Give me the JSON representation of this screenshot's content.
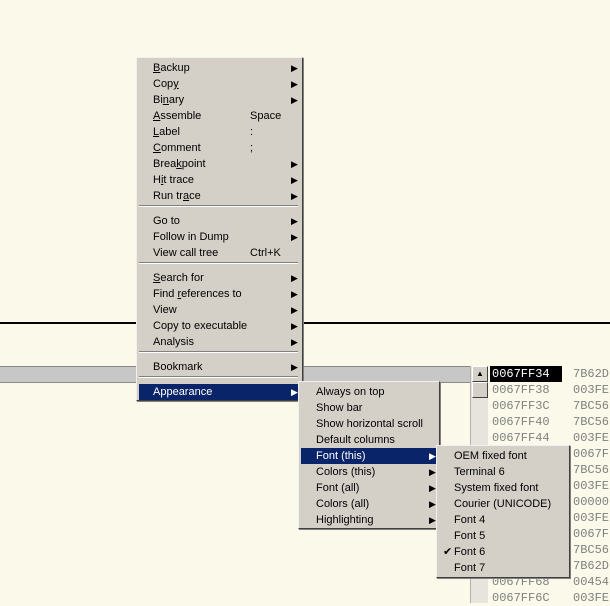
{
  "main_menu": {
    "items": [
      {
        "pre": "",
        "u": "B",
        "post": "ackup",
        "shortcut": "",
        "arrow": "▶"
      },
      {
        "pre": "Cop",
        "u": "y",
        "post": "",
        "shortcut": "",
        "arrow": "▶"
      },
      {
        "pre": "Bi",
        "u": "n",
        "post": "ary",
        "shortcut": "",
        "arrow": "▶"
      },
      {
        "pre": "",
        "u": "A",
        "post": "ssemble",
        "shortcut": "Space",
        "arrow": ""
      },
      {
        "pre": "",
        "u": "L",
        "post": "abel",
        "shortcut": ":",
        "arrow": ""
      },
      {
        "pre": "",
        "u": "C",
        "post": "omment",
        "shortcut": ";",
        "arrow": ""
      },
      {
        "pre": "Brea",
        "u": "k",
        "post": "point",
        "shortcut": "",
        "arrow": "▶"
      },
      {
        "pre": "H",
        "u": "i",
        "post": "t trace",
        "shortcut": "",
        "arrow": "▶"
      },
      {
        "pre": "Run tr",
        "u": "a",
        "post": "ce",
        "shortcut": "",
        "arrow": "▶"
      },
      {
        "pre": "Go to",
        "u": "",
        "post": "",
        "shortcut": "",
        "arrow": "▶"
      },
      {
        "pre": "Follow in Dump",
        "u": "",
        "post": "",
        "shortcut": "",
        "arrow": "▶"
      },
      {
        "pre": "View call tree",
        "u": "",
        "post": "",
        "shortcut": "Ctrl+K",
        "arrow": ""
      },
      {
        "pre": "",
        "u": "S",
        "post": "earch for",
        "shortcut": "",
        "arrow": "▶"
      },
      {
        "pre": "Find ",
        "u": "r",
        "post": "eferences to",
        "shortcut": "",
        "arrow": "▶"
      },
      {
        "pre": "View",
        "u": "",
        "post": "",
        "shortcut": "",
        "arrow": "▶"
      },
      {
        "pre": "Copy to executable",
        "u": "",
        "post": "",
        "shortcut": "",
        "arrow": "▶"
      },
      {
        "pre": "Analysis",
        "u": "",
        "post": "",
        "shortcut": "",
        "arrow": "▶"
      },
      {
        "pre": "Bookmark",
        "u": "",
        "post": "",
        "shortcut": "",
        "arrow": "▶"
      },
      {
        "pre": "Appearance",
        "u": "",
        "post": "",
        "shortcut": "",
        "arrow": "▶"
      }
    ]
  },
  "appearance_menu": {
    "items": [
      {
        "label": "Always on top",
        "arrow": ""
      },
      {
        "label": "Show bar",
        "arrow": ""
      },
      {
        "label": "Show horizontal scroll",
        "arrow": ""
      },
      {
        "label": "Default columns",
        "arrow": ""
      },
      {
        "label": "Font (this)",
        "arrow": "▶"
      },
      {
        "label": "Colors (this)",
        "arrow": "▶"
      },
      {
        "label": "Font (all)",
        "arrow": "▶"
      },
      {
        "label": "Colors (all)",
        "arrow": "▶"
      },
      {
        "label": "Highlighting",
        "arrow": "▶"
      }
    ]
  },
  "font_menu": {
    "items": [
      {
        "label": "OEM fixed font",
        "check": ""
      },
      {
        "label": "Terminal 6",
        "check": ""
      },
      {
        "label": "System fixed font",
        "check": ""
      },
      {
        "label": "Courier (UNICODE)",
        "check": ""
      },
      {
        "label": "Font 4",
        "check": ""
      },
      {
        "label": "Font 5",
        "check": ""
      },
      {
        "label": "Font 6",
        "check": "✔"
      },
      {
        "label": "Font 7",
        "check": ""
      }
    ]
  },
  "scrollbar": {
    "up_arrow": "▲"
  },
  "stack": {
    "rows": [
      {
        "addr": "0067FF34",
        "val": "7B62D"
      },
      {
        "addr": "0067FF38",
        "val": "003FE"
      },
      {
        "addr": "0067FF3C",
        "val": "7BC56"
      },
      {
        "addr": "0067FF40",
        "val": "7BC56"
      },
      {
        "addr": "0067FF44",
        "val": "003FE"
      },
      {
        "addr": "",
        "val": "0067F"
      },
      {
        "addr": "",
        "val": "7BC56"
      },
      {
        "addr": "",
        "val": "003FE"
      },
      {
        "addr": "",
        "val": "00000"
      },
      {
        "addr": "",
        "val": "003FE"
      },
      {
        "addr": "",
        "val": "0067F"
      },
      {
        "addr": "",
        "val": "7BC56"
      },
      {
        "addr": "",
        "val": "7B62D"
      },
      {
        "addr": "0067FF68",
        "val": "00454"
      },
      {
        "addr": "0067FF6C",
        "val": "003FE"
      }
    ]
  }
}
